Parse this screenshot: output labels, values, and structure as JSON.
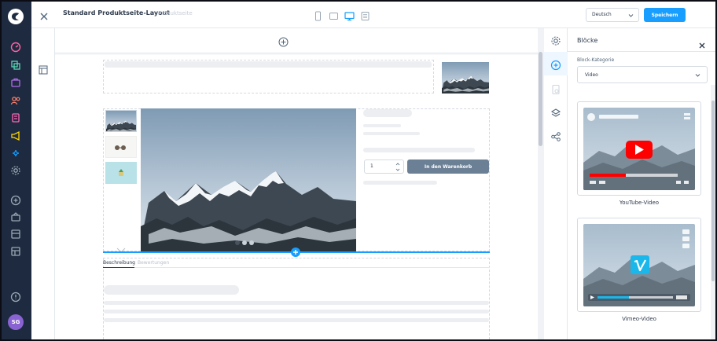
{
  "header": {
    "title": "Standard Produktseite-Layout",
    "subtitle": "Produktseite",
    "language": "Deutsch",
    "save_label": "Speichern",
    "device_icons": [
      "mobile-icon",
      "tablet-icon",
      "desktop-icon",
      "list-view-icon"
    ]
  },
  "sidebar": {
    "icons": [
      "dashboard-icon",
      "catalog-icon",
      "orders-icon",
      "customers-icon",
      "content-icon",
      "marketing-icon",
      "extensions-icon",
      "settings-icon",
      "add-icon",
      "sales-channel-icon",
      "storefront-icon",
      "headless-icon",
      "help-icon"
    ],
    "avatar_initials": "SG"
  },
  "canvas": {
    "quantity": "1",
    "add_to_cart_label": "In den Warenkorb",
    "tabs": [
      "Beschreibung",
      "Bewertungen"
    ]
  },
  "panel": {
    "title": "Blöcke",
    "category_label": "Block-Kategorie",
    "category_value": "Video",
    "blocks": [
      {
        "label": "YouTube-Video"
      },
      {
        "label": "Vimeo-Video"
      }
    ]
  },
  "colors": {
    "nav_bg": "#1e2a3f",
    "accent": "#189eff",
    "cart_button": "#6b7f95",
    "youtube_red": "#ff0000",
    "vimeo_blue": "#1ab7ea"
  }
}
